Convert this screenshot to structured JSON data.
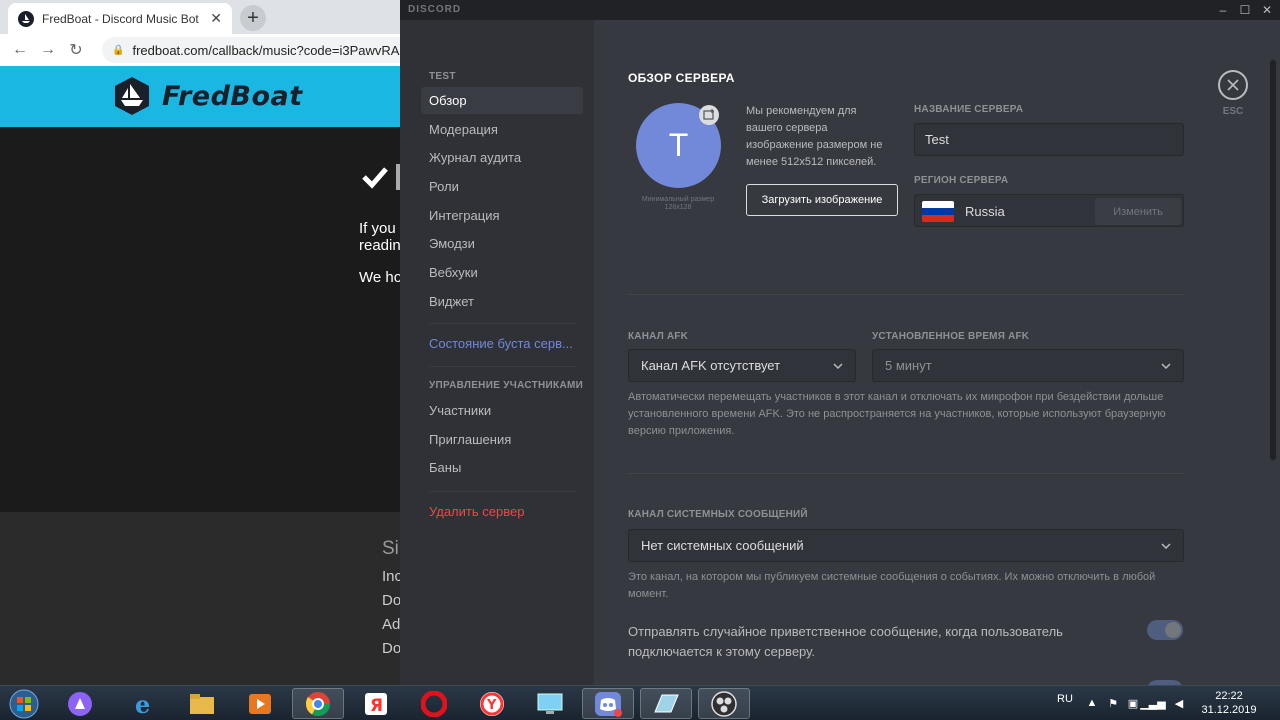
{
  "browser": {
    "tab_title": "FredBoat - Discord Music Bot",
    "tab_close": "✕",
    "new_tab": "+",
    "url": "fredboat.com/callback/music?code=i3PawvRA",
    "nav": {
      "back": "←",
      "forward": "→",
      "reload": "↻"
    }
  },
  "fredboat": {
    "logo_text": "FredBoat",
    "body_lines": [
      "If you",
      "readin",
      "We ho"
    ],
    "footer_lines": [
      "Si",
      "Inc",
      "Do",
      "Ad",
      "Do"
    ]
  },
  "discord": {
    "brand": "DISCORD",
    "window_controls": {
      "minimize": "–",
      "maximize": "☐",
      "close": "✕"
    },
    "sidebar": {
      "server_heading": "TEST",
      "items": [
        {
          "label": "Обзор",
          "active": true
        },
        {
          "label": "Модерация"
        },
        {
          "label": "Журнал аудита"
        },
        {
          "label": "Роли"
        },
        {
          "label": "Интеграция"
        },
        {
          "label": "Эмодзи"
        },
        {
          "label": "Вебхуки"
        },
        {
          "label": "Виджет"
        }
      ],
      "boost_status": "Состояние буста серв...",
      "members_heading": "УПРАВЛЕНИЕ УЧАСТНИКАМИ",
      "member_items": [
        {
          "label": "Участники"
        },
        {
          "label": "Приглашения"
        },
        {
          "label": "Баны"
        }
      ],
      "delete_server": "Удалить сервер"
    },
    "overview": {
      "title": "ОБЗОР СЕРВЕРА",
      "avatar_letter": "T",
      "min_size": "Минимальный размер 128x128",
      "upload_hint": "Мы рекомендуем для вашего сервера изображение размером не менее 512x512 пикселей.",
      "upload_button": "Загрузить изображение",
      "server_name_label": "НАЗВАНИЕ СЕРВЕРА",
      "server_name_value": "Test",
      "region_label": "РЕГИОН СЕРВЕРА",
      "region_value": "Russia",
      "change_button": "Изменить",
      "afk_channel_label": "КАНАЛ AFK",
      "afk_channel_value": "Канал AFK отсутствует",
      "afk_timeout_label": "УСТАНОВЛЕННОЕ ВРЕМЯ AFK",
      "afk_timeout_value": "5 минут",
      "afk_description": "Автоматически перемещать участников в этот канал и отключать их микрофон при бездействии дольше установленного времени AFK. Это не распространяется на участников, которые используют браузерную версию приложения.",
      "system_channel_label": "КАНАЛ СИСТЕМНЫХ СООБЩЕНИЙ",
      "system_channel_value": "Нет системных сообщений",
      "system_description": "Это канал, на котором мы публикуем системные сообщения о событиях. Их можно отключить в любой момент.",
      "welcome_toggle_label": "Отправлять случайное приветственное сообщение, когда пользователь подключается к этому серверу.",
      "close_label": "ESC"
    },
    "colors": {
      "accent": "#7289da",
      "danger": "#f04747",
      "background": "#36393f",
      "sidebar": "#2f3136"
    }
  },
  "taskbar": {
    "apps": [
      "start-orb",
      "alice",
      "internet-explorer",
      "file-explorer",
      "media-player",
      "chrome",
      "yandex-search",
      "opera",
      "yandex-browser",
      "computer",
      "discord",
      "notepad",
      "obs"
    ],
    "language": "RU",
    "time": "22:22",
    "date": "31.12.2019"
  }
}
